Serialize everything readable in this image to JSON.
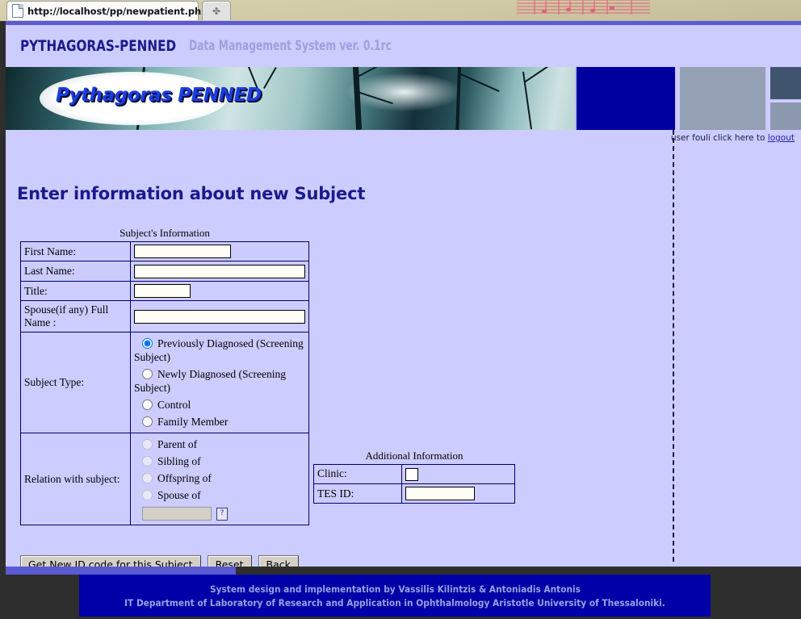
{
  "browser": {
    "tab_title": "http://localhost/pp/newpatient.php",
    "tab_doc_icon": "document-icon",
    "new_tab_glyph": "✤"
  },
  "app": {
    "name": "PYTHAGORAS-PENNED",
    "subtitle": "Data Management System ver. 0.1rc"
  },
  "banner": {
    "logo_text": "Pythagoras  PENNED",
    "photo_alt": "winter-forest-photo"
  },
  "userbar": {
    "text": "user fouli click here to ",
    "logout_label": "logout"
  },
  "page": {
    "title": "Enter information about new Subject"
  },
  "subject_form": {
    "caption": "Subject's Information",
    "fields": [
      {
        "label": "First Name:",
        "value": "",
        "placeholder": ""
      },
      {
        "label": "Last Name:",
        "value": "",
        "placeholder": ""
      },
      {
        "label": "Title:",
        "value": "",
        "placeholder": ""
      },
      {
        "label": "Spouse(if any) Full Name :",
        "value": "",
        "placeholder": ""
      }
    ],
    "subject_type": {
      "label": "Subject Type:",
      "options": [
        {
          "label": "Previously Diagnosed (Screening Subject)",
          "selected": true
        },
        {
          "label": "Newly Diagnosed (Screening Subject)",
          "selected": false
        },
        {
          "label": "Control",
          "selected": false
        },
        {
          "label": "Family Member",
          "selected": false
        }
      ]
    },
    "relation": {
      "label": "Relation with subject:",
      "options": [
        {
          "label": "Parent of",
          "selected": false
        },
        {
          "label": "Offspring of",
          "selected": false
        },
        {
          "label": "Sibling of",
          "selected": false
        },
        {
          "label": "Spouse of",
          "selected": false
        }
      ],
      "related_input_value": "",
      "helper_icon": "broken-image-icon",
      "helper_glyph": "?"
    }
  },
  "additional_info": {
    "caption": "Additional Information",
    "rows": [
      {
        "label": "Clinic:",
        "control": "empty-select-box",
        "value": ""
      },
      {
        "label": "TES ID:",
        "control": "text-input",
        "value": ""
      }
    ]
  },
  "buttons": {
    "get_id": "Get New ID code for this Subject",
    "reset": "Reset",
    "back": "Back"
  },
  "footer": {
    "line1": "System design and implementation by Vassilis Kilintzis & Antoniadis Antonis",
    "line2": "IT Department of Laboratory of Research and Application in Ophthalmology Aristotle University of Thessaloniki."
  },
  "colors": {
    "page_background": "#ccccff",
    "title_blue": "#1a1a8c",
    "banner_blue_block": "#0000a0",
    "footer_background": "#0000a8",
    "footer_text": "#9aa0e0",
    "table_border": "#000070",
    "desktop": "#2e2e2e"
  }
}
